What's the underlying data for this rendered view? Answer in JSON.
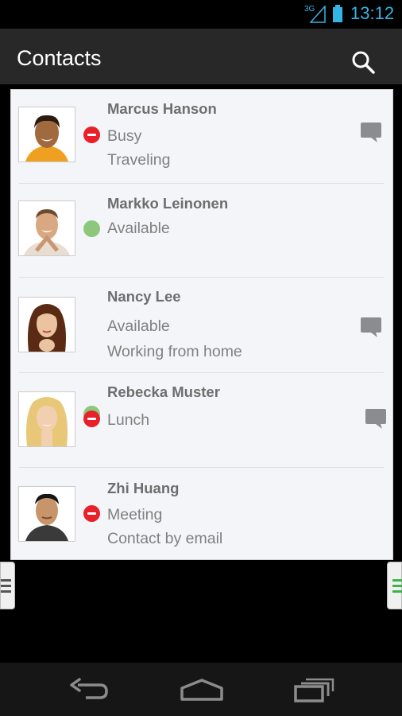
{
  "status_bar": {
    "network": "3G",
    "time": "13:12"
  },
  "header": {
    "title": "Contacts"
  },
  "contacts": [
    {
      "name": "Marcus Hanson",
      "status": "Busy",
      "note": "Traveling"
    },
    {
      "name": "Markko Leinonen",
      "status": "Available"
    },
    {
      "name": "Nancy Lee",
      "status": "Available",
      "note": "Working from home"
    },
    {
      "name": "Rebecka Muster",
      "status": "Lunch"
    },
    {
      "name": "Zhi Huang",
      "status": "Meeting",
      "note": "Contact by email"
    }
  ],
  "icons": {
    "search": "search-icon",
    "chat": "chat-bubble-icon",
    "status_busy": "busy-status-icon",
    "status_available": "available-status-icon",
    "back": "back-icon",
    "home": "home-icon",
    "recents": "recent-apps-icon"
  },
  "colors": {
    "accent": "#33b5e5",
    "busy": "#e8202a",
    "available": "#8dc77b",
    "handle_accent": "#3cb44b"
  }
}
